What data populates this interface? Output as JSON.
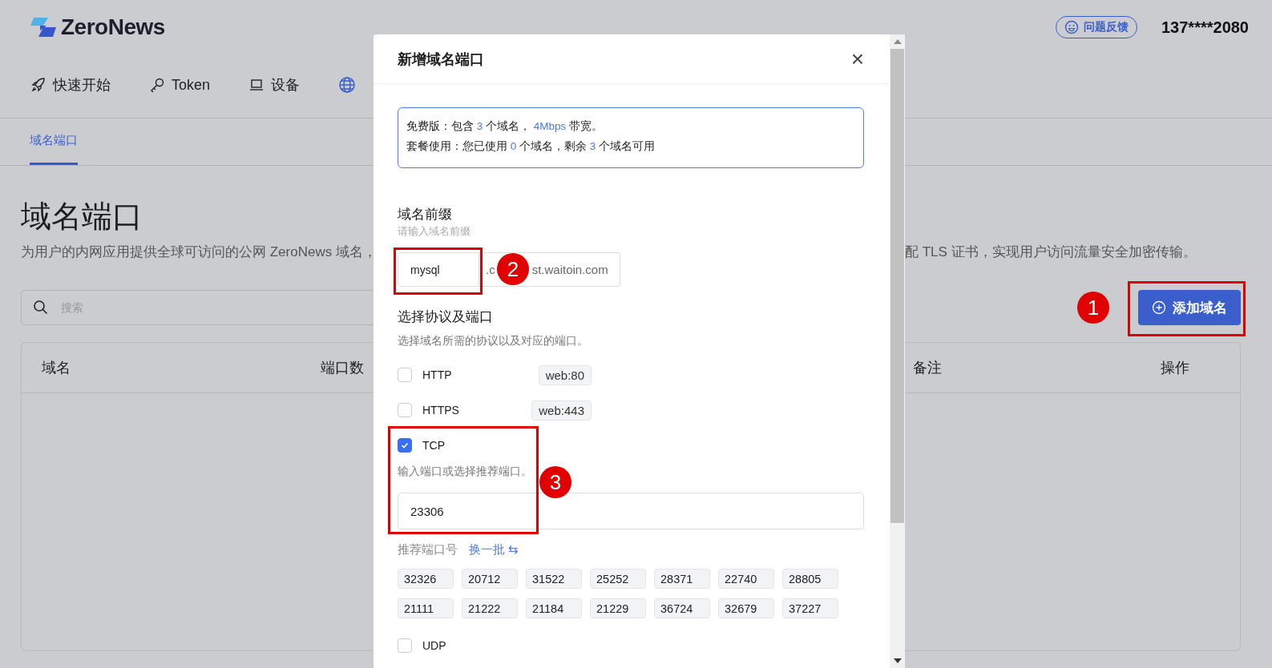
{
  "header": {
    "logo": "ZeroNews",
    "feedback": "问题反馈",
    "user": "137****2080"
  },
  "nav": [
    {
      "kind": "rocket",
      "label": "快速开始",
      "selected": false
    },
    {
      "kind": "key",
      "label": "Token",
      "selected": false
    },
    {
      "kind": "laptop",
      "label": "设备",
      "selected": false
    },
    {
      "kind": "globe",
      "selected": true
    }
  ],
  "subtabs": [
    {
      "label": "域名端口",
      "selected": true
    }
  ],
  "page": {
    "title": "域名端口",
    "description_left": "为用户的内网应用提供全球可访问的公网 ZeroNews 域名，",
    "description_right": "配 TLS 证书，实现用户访问流量安全加密传输。",
    "search": {
      "placeholder": "搜索"
    },
    "add_button": "添加域名"
  },
  "table": {
    "columns_left": [
      "域名",
      "端口数"
    ],
    "columns_right": [
      "备注",
      "操作"
    ]
  },
  "dialog": {
    "title": "新增域名端口",
    "close": "×",
    "info": [
      [
        {
          "text": "免费版：包含 ",
          "highlight": false
        },
        {
          "text": "3",
          "highlight": true
        },
        {
          "text": " 个域名， ",
          "highlight": false
        },
        {
          "text": "4Mbps",
          "highlight": true
        },
        {
          "text": " 带宽。",
          "highlight": false
        }
      ],
      [
        {
          "text": "套餐使用：您已使用 ",
          "highlight": false
        },
        {
          "text": "0",
          "highlight": true
        },
        {
          "text": " 个域名，剩余 ",
          "highlight": false
        },
        {
          "text": "3",
          "highlight": true
        },
        {
          "text": " 个域名可用",
          "highlight": false
        }
      ]
    ],
    "prefix": {
      "label": "域名前缀",
      "hint": "请输入域名前缀",
      "value": "mysql",
      "suffix_start": ".c",
      "suffix_end": "st.waitoin.com"
    },
    "protocol_label": "选择协议及端口",
    "protocol_hint": "选择域名所需的协议以及对应的端口。",
    "protocols": [
      {
        "name": "HTTP",
        "checked": false,
        "tag": "web:80"
      },
      {
        "name": "HTTPS",
        "checked": false,
        "tag": "web:443"
      },
      {
        "name": "TCP",
        "checked": true,
        "port_hint": "输入端口或选择推荐端口。",
        "port_value": "23306",
        "recommend_label": "推荐端口号",
        "refresh_label": "换一批 ⇆",
        "ports": [
          "32326",
          "20712",
          "31522",
          "25252",
          "28371",
          "22740",
          "28805",
          "21111",
          "21222",
          "21184",
          "21229",
          "36724",
          "32679",
          "37227"
        ]
      },
      {
        "name": "UDP",
        "checked": false
      }
    ]
  },
  "annotations": [
    {
      "label": "1"
    },
    {
      "label": "2"
    },
    {
      "label": "3"
    }
  ]
}
